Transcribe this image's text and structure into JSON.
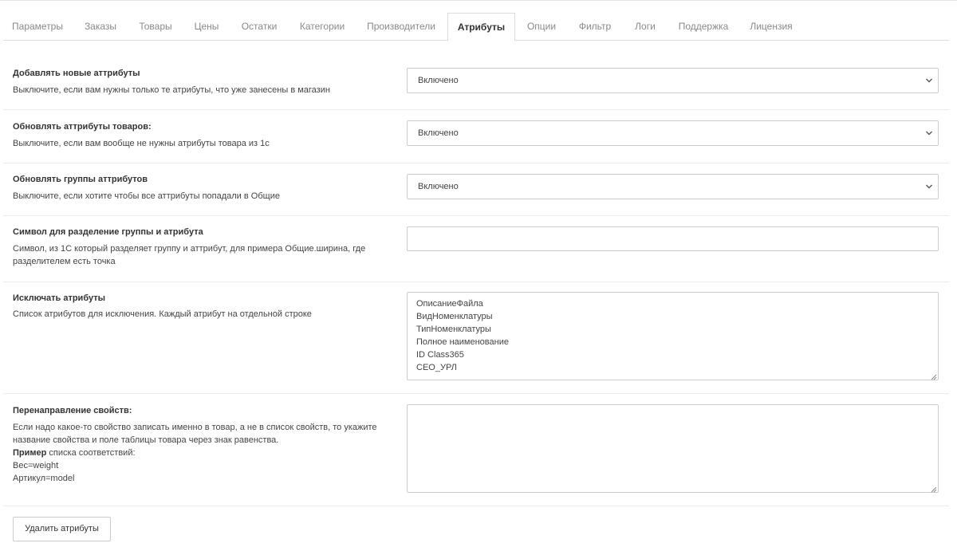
{
  "tabs": [
    {
      "label": "Параметры"
    },
    {
      "label": "Заказы"
    },
    {
      "label": "Товары"
    },
    {
      "label": "Цены"
    },
    {
      "label": "Остатки"
    },
    {
      "label": "Категории"
    },
    {
      "label": "Производители"
    },
    {
      "label": "Атрибуты",
      "active": true
    },
    {
      "label": "Опции"
    },
    {
      "label": "Фильтр"
    },
    {
      "label": "Логи"
    },
    {
      "label": "Поддержка"
    },
    {
      "label": "Лицензия"
    }
  ],
  "settings": {
    "add_new": {
      "title": "Добавлять новые аттрибуты",
      "help": "Выключите, если вам нужны только те атрибуты, что уже занесены в магазин",
      "value": "Включено",
      "icon": "chevron-down-icon"
    },
    "update_product_attrs": {
      "title": "Обновлять аттрибуты товаров:",
      "help": "Выключите, если вам вообще не нужны атрибуты товара из 1с",
      "value": "Включено",
      "icon": "chevron-down-icon"
    },
    "update_groups": {
      "title": "Обновлять группы аттрибутов",
      "help": "Выключите, если хотите чтобы все аттрибуты попадали в Общие",
      "value": "Включено",
      "icon": "chevron-down-icon"
    },
    "separator": {
      "title": "Символ для разделение группы и атрибута",
      "help": "Символ, из 1С который разделяет группу и аттрибут, для примера Общие.ширина, где разделителем есть точка",
      "value": ""
    },
    "exclude": {
      "title": "Исключать атрибуты",
      "help": "Список атрибутов для исключения. Каждый атрибут на отдельной строке",
      "lines": [
        "ОписаниеФайла",
        "ВидНоменклатуры",
        "ТипНоменклатуры",
        "Полное наименование",
        "ID Class365",
        "СЕО_УРЛ"
      ]
    },
    "redirect": {
      "title": "Перенаправление свойств:",
      "help": "Если надо какое-то свойство записать именно в товар, а не в список свойств, то укажите название свойства и поле таблицы товара через знак равенства.",
      "example_bold": "Пример",
      "example_rest": " списка соответствий:",
      "example_line1": "Вес=weight",
      "example_line2": "Артикул=model",
      "value": ""
    }
  },
  "actions": {
    "delete_label": "Удалить атрибуты"
  }
}
